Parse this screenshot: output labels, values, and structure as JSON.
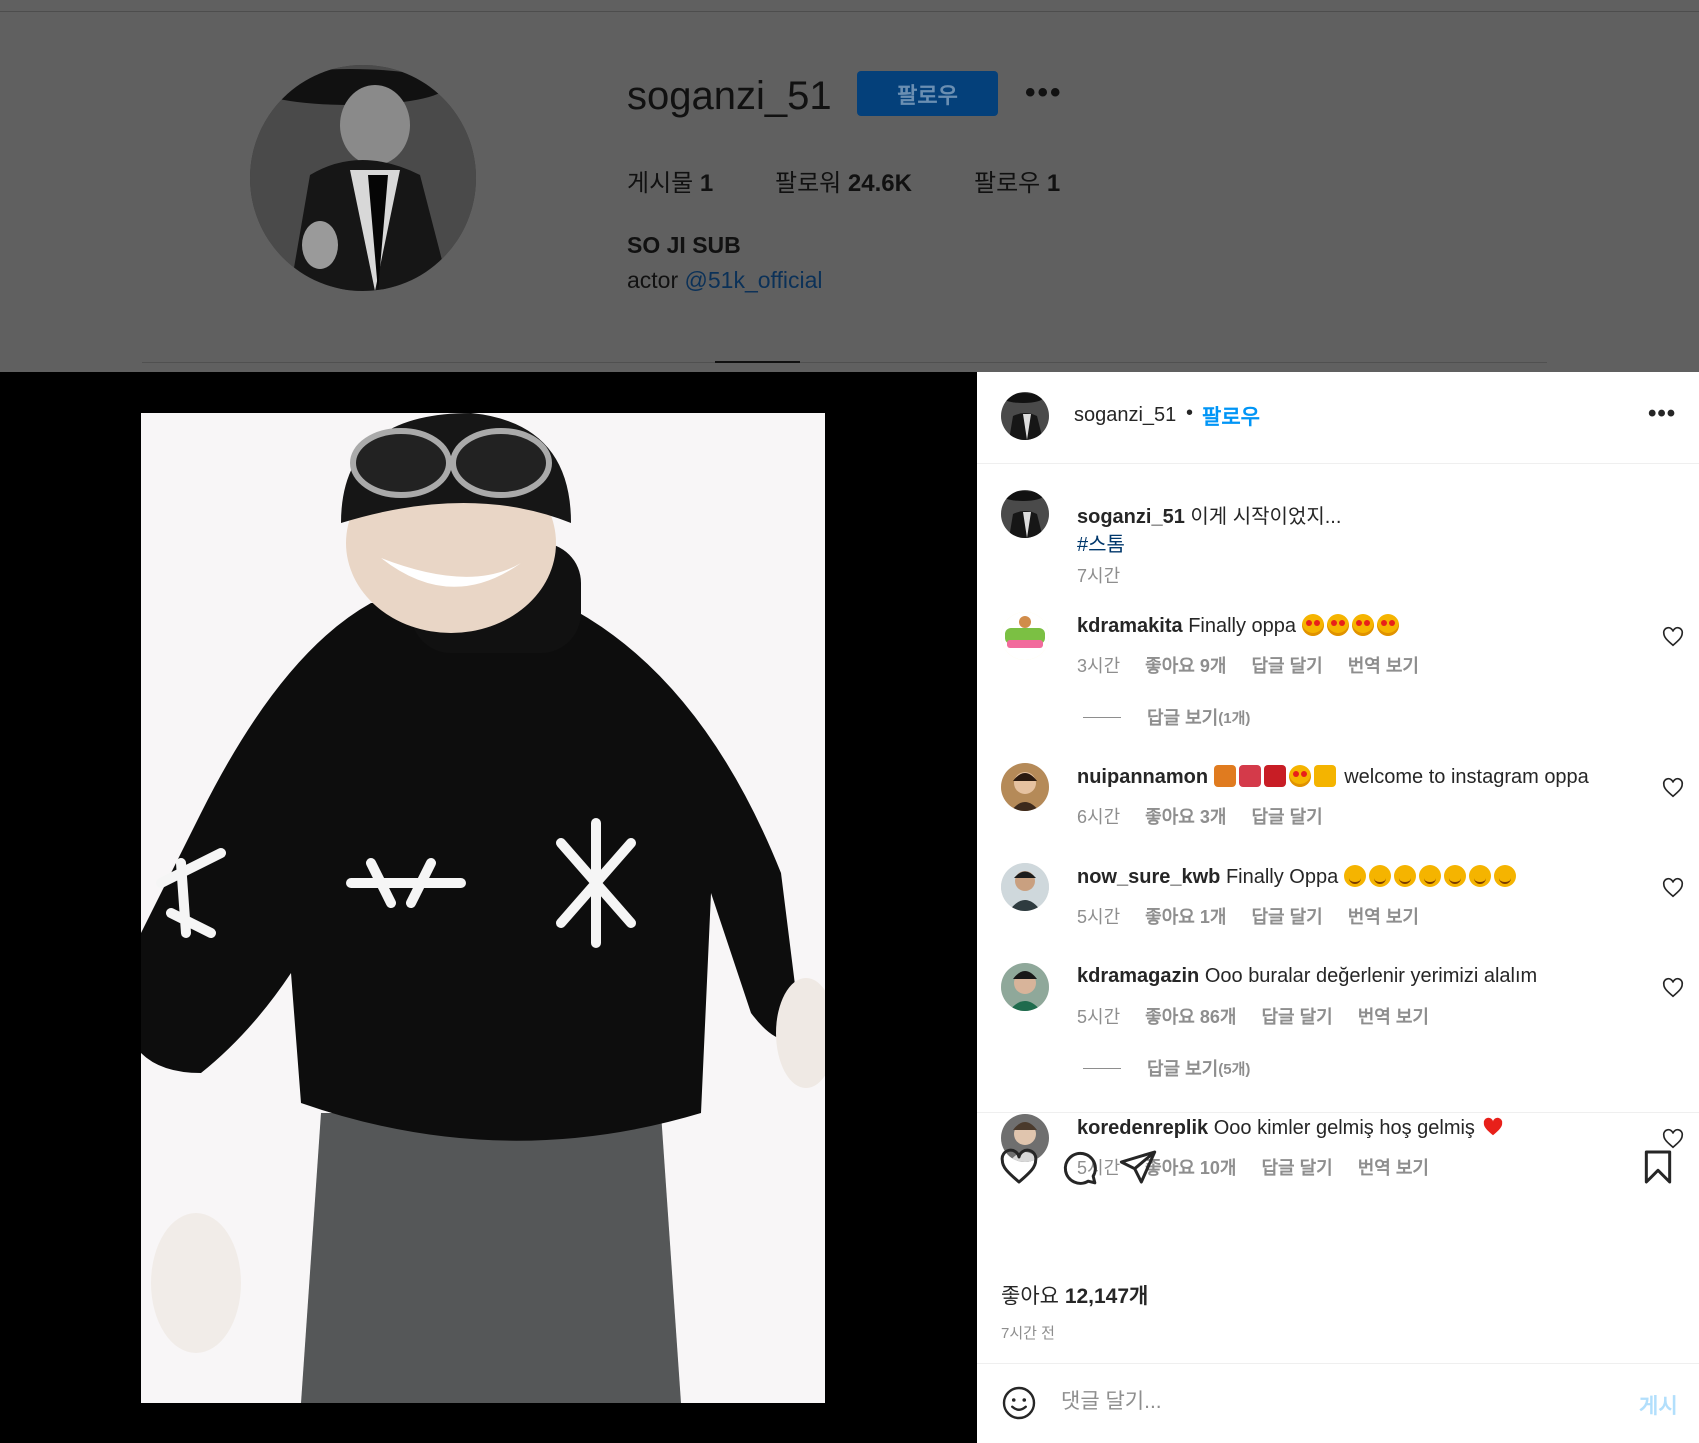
{
  "profile": {
    "username": "soganzi_51",
    "follow_label": "팔로우",
    "more_label": "•••",
    "stats": {
      "posts_label": "게시물",
      "posts_value": "1",
      "followers_label": "팔로워",
      "followers_value": "24.6K",
      "following_label": "팔로우",
      "following_value": "1"
    },
    "full_name": "SO JI SUB",
    "bio_prefix": "actor",
    "bio_mention": "@51k_official"
  },
  "post": {
    "header": {
      "username": "soganzi_51",
      "dot": "•",
      "follow_label": "팔로우",
      "more_label": "•••"
    },
    "caption": {
      "username": "soganzi_51",
      "text": "이게 시작이었지...",
      "hashtag": "#스톰",
      "time": "7시간"
    },
    "comments": [
      {
        "username": "kdramakita",
        "text": "Finally oppa",
        "emojis": [
          "heart-eyes",
          "heart-eyes",
          "heart-eyes",
          "heart-eyes"
        ],
        "time": "3시간",
        "likes_label": "좋아요",
        "likes_value": "9개",
        "reply_label": "답글 달기",
        "translate_label": "번역 보기",
        "view_replies": "답글 보기",
        "view_replies_count": "(1개)"
      },
      {
        "username": "nuipannamon",
        "text": "welcome to instagram oppa",
        "emojis": [
          "misc",
          "misc",
          "misc",
          "heart-eyes",
          "misc"
        ],
        "time": "6시간",
        "likes_label": "좋아요",
        "likes_value": "3개",
        "reply_label": "답글 달기"
      },
      {
        "username": "now_sure_kwb",
        "text": "Finally Oppa",
        "emojis": [
          "smile-hearts",
          "smile-hearts",
          "smile-hearts",
          "smile-hearts",
          "smile-hearts",
          "smile-hearts",
          "smile-hearts"
        ],
        "time": "5시간",
        "likes_label": "좋아요",
        "likes_value": "1개",
        "reply_label": "답글 달기",
        "translate_label": "번역 보기"
      },
      {
        "username": "kdramagazin",
        "text": "Ooo buralar değerlenir yerimizi alalım",
        "time": "5시간",
        "likes_label": "좋아요",
        "likes_value": "86개",
        "reply_label": "답글 달기",
        "translate_label": "번역 보기",
        "view_replies": "답글 보기",
        "view_replies_count": "(5개)"
      },
      {
        "username": "koredenreplik",
        "text": "Ooo kimler gelmiş hoş gelmiş",
        "emojis": [
          "red-heart"
        ],
        "time": "5시간",
        "likes_label": "좋아요",
        "likes_value": "10개",
        "reply_label": "답글 달기",
        "translate_label": "번역 보기"
      }
    ],
    "likes_label": "좋아요",
    "likes_value": "12,147개",
    "posted_time": "7시간 전",
    "comment_placeholder": "댓글 달기...",
    "post_label": "게시"
  },
  "icons": [
    "heart-icon",
    "comment-icon",
    "share-icon",
    "bookmark-icon",
    "emoji-icon",
    "more-icon"
  ],
  "colors": {
    "accent": "#0095f6",
    "link": "#00376b",
    "muted": "#8e8e8e"
  }
}
